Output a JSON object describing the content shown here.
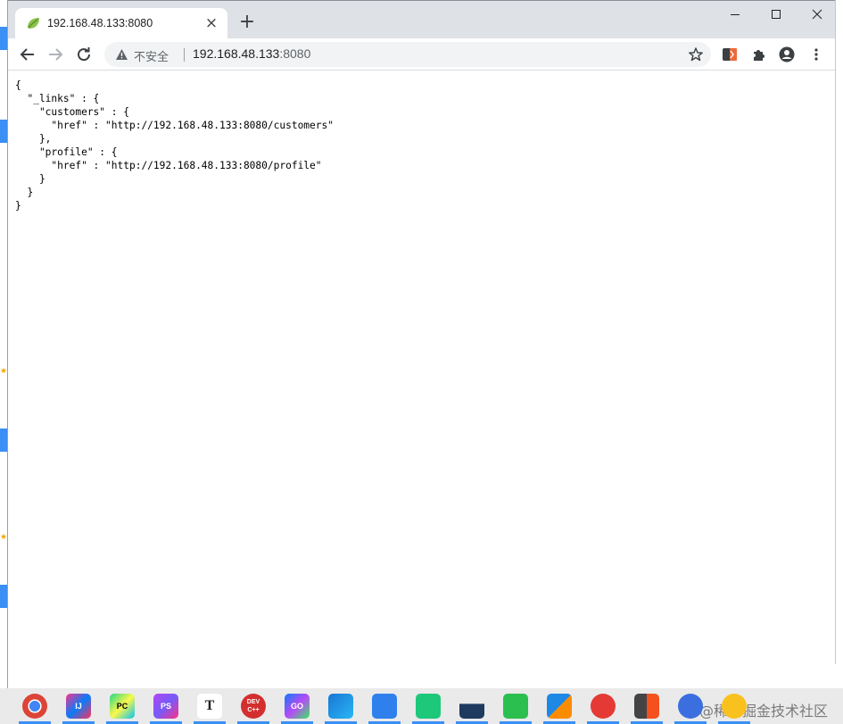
{
  "tab": {
    "title": "192.168.48.133:8080",
    "close_glyph": "×",
    "favicon": "spring-leaf-icon"
  },
  "new_tab_glyph": "+",
  "omnibox": {
    "security_label": "不安全",
    "url_host": "192.168.48.133",
    "url_port": ":8080"
  },
  "json_lines": [
    "{",
    "  \"_links\" : {",
    "    \"customers\" : {",
    "      \"href\" : \"http://192.168.48.133:8080/customers\"",
    "    },",
    "    \"profile\" : {",
    "      \"href\" : \"http://192.168.48.133:8080/profile\"",
    "    }",
    "  }",
    "}"
  ],
  "taskbar": {
    "items": [
      {
        "name": "chrome",
        "label": ""
      },
      {
        "name": "intellij-idea",
        "label": "IJ"
      },
      {
        "name": "pycharm",
        "label": "PC"
      },
      {
        "name": "phpstorm",
        "label": "PS"
      },
      {
        "name": "typora",
        "label": "T"
      },
      {
        "name": "dev-cpp",
        "label": "DEV C++"
      },
      {
        "name": "goland",
        "label": "GO"
      },
      {
        "name": "app-bird",
        "label": ""
      },
      {
        "name": "app-blue-arrow",
        "label": ""
      },
      {
        "name": "app-green-bag",
        "label": ""
      },
      {
        "name": "app-cat",
        "label": ""
      },
      {
        "name": "app-green-leaf",
        "label": ""
      },
      {
        "name": "app-box",
        "label": ""
      },
      {
        "name": "netease-music",
        "label": ""
      },
      {
        "name": "app-orange-book",
        "label": ""
      },
      {
        "name": "app-blue-circle",
        "label": ""
      },
      {
        "name": "app-yellow",
        "label": ""
      }
    ],
    "watermark": "@稀土掘金技术社区"
  },
  "colors": {
    "titlebar": "#dee1e6",
    "omnibox": "#f1f3f4",
    "accent_blue": "#3b8ff5"
  }
}
